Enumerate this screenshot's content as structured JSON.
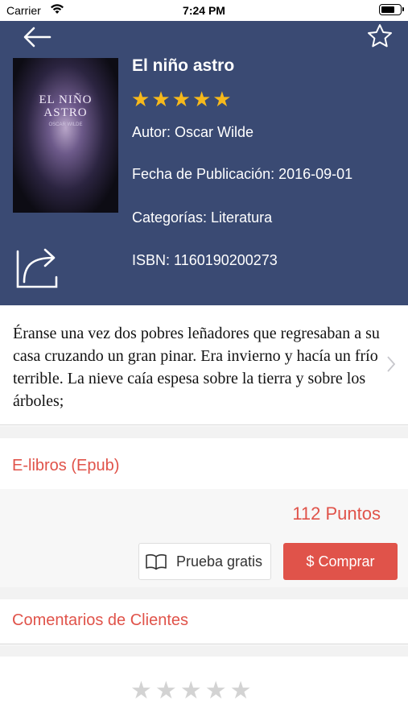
{
  "status_bar": {
    "carrier": "Carrier",
    "time": "7:24 PM"
  },
  "book": {
    "title": "El niño astro",
    "rating": 5,
    "author": "Autor: Oscar Wilde",
    "pub_date": "Fecha de Publicación: 2016-09-01",
    "categories": "Categorías: Literatura",
    "isbn": "ISBN: 1160190200273",
    "cover": {
      "title_line1": "EL NIÑO",
      "title_line2": "ASTRO",
      "author": "OSCAR WILDE"
    }
  },
  "description": "Éranse una vez dos pobres leñadores que regresaban a su casa cruzando un gran pinar. Era invierno y hacía un frío terrible. La nieve caía espesa sobre la tierra y sobre los árboles;",
  "ebook": {
    "section_label": "E-libros (Epub)",
    "points": "112 Puntos",
    "trial_label": "Prueba gratis",
    "buy_label": "$ Comprar"
  },
  "reviews": {
    "section_label": "Comentarios de Clientes",
    "user_rating": 0
  },
  "icons": {
    "back": "arrow-left-icon",
    "favorite": "star-outline-icon",
    "share": "share-icon",
    "trial": "open-book-icon",
    "chevron": "chevron-right-icon"
  },
  "colors": {
    "header_bg": "#3a4a73",
    "accent": "#e0534a",
    "star_gold": "#f6b91b",
    "star_empty": "#d3d3d3"
  }
}
